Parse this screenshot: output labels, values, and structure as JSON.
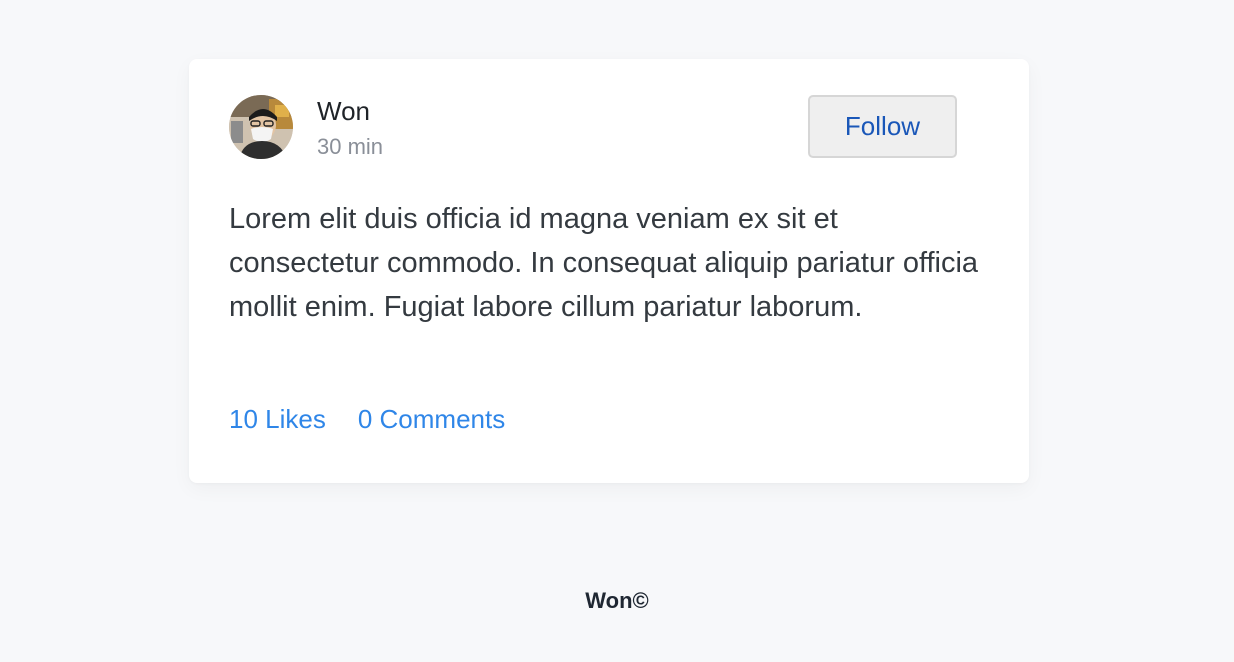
{
  "post": {
    "author": {
      "name": "Won",
      "timestamp": "30 min",
      "avatar_icon": "user-photo-avatar"
    },
    "follow_label": "Follow",
    "body": "Lorem elit duis officia id magna veniam ex sit et consectetur commodo. In consequat aliquip pariatur officia mollit enim. Fugiat labore cillum pariatur laborum.",
    "likes_label": "10 Likes",
    "comments_label": "0 Comments"
  },
  "footer": {
    "text": "Won©"
  },
  "colors": {
    "background": "#f7f8fa",
    "card": "#ffffff",
    "link": "#2f86e8",
    "follow_text": "#1a57b8",
    "muted": "#8a8f98"
  }
}
